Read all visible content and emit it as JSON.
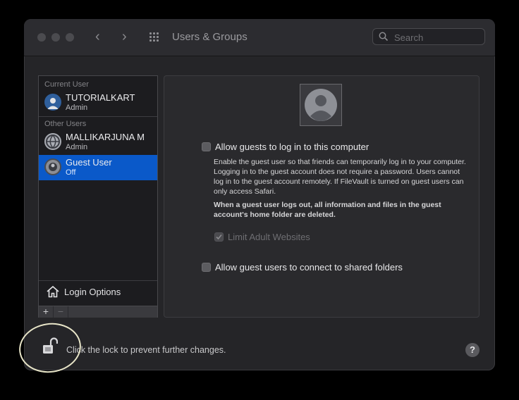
{
  "window": {
    "title": "Users & Groups",
    "search_placeholder": "Search"
  },
  "sidebar": {
    "current_user_label": "Current User",
    "other_users_label": "Other Users",
    "users": [
      {
        "name": "TUTORIALKART",
        "role": "Admin",
        "selected": false,
        "avatar_icon": "user-photo-icon"
      },
      {
        "name": "MALLIKARJUNA M",
        "role": "Admin",
        "selected": false,
        "avatar_icon": "globe-user-icon"
      },
      {
        "name": "Guest User",
        "role": "Off",
        "selected": true,
        "avatar_icon": "guest-user-icon"
      }
    ],
    "login_options_label": "Login Options",
    "add_label": "+",
    "remove_label": "−"
  },
  "content": {
    "allow_guests_label": "Allow guests to log in to this computer",
    "allow_guests_checked": false,
    "guest_description": "Enable the guest user so that friends can temporarily log in to your computer. Logging in to the guest account does not require a password. Users cannot log in to the guest account remotely. If FileVault is turned on guest users can only access Safari.",
    "guest_warning": "When a guest user logs out, all information and files in the guest account's home folder are deleted.",
    "limit_adult_label": "Limit Adult Websites",
    "limit_adult_checked": true,
    "limit_adult_enabled": false,
    "shared_folders_label": "Allow guest users to connect to shared folders",
    "shared_folders_checked": false
  },
  "footer": {
    "lock_text": "Click the lock to prevent further changes.",
    "help_label": "?"
  },
  "colors": {
    "selection": "#0a59c9",
    "window_bg": "#252528",
    "annotation": "#e8e5c8"
  }
}
